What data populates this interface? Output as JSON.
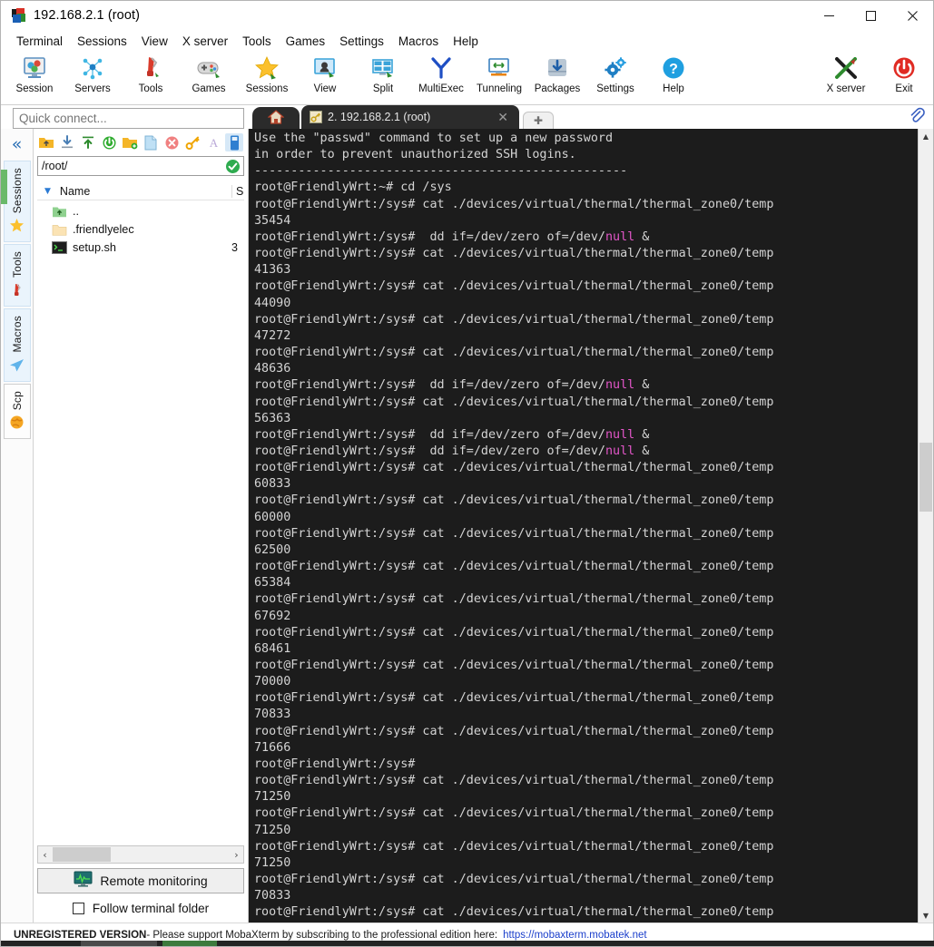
{
  "window": {
    "title": "192.168.2.1 (root)",
    "icon": "mobaxterm-logo-icon",
    "minimize": "–",
    "maximize": "□",
    "close": "✕"
  },
  "menubar": {
    "items": [
      {
        "label": "Terminal"
      },
      {
        "label": "Sessions"
      },
      {
        "label": "View"
      },
      {
        "label": "X server"
      },
      {
        "label": "Tools"
      },
      {
        "label": "Games"
      },
      {
        "label": "Settings"
      },
      {
        "label": "Macros"
      },
      {
        "label": "Help"
      }
    ]
  },
  "toolbar": {
    "buttons": [
      {
        "label": "Session",
        "icon": "session-icon"
      },
      {
        "label": "Servers",
        "icon": "servers-icon"
      },
      {
        "label": "Tools",
        "icon": "tools-knife-icon"
      },
      {
        "label": "Games",
        "icon": "gamepad-icon"
      },
      {
        "label": "Sessions",
        "icon": "star-icon"
      },
      {
        "label": "View",
        "icon": "view-monitor-icon"
      },
      {
        "label": "Split",
        "icon": "split-screen-icon"
      },
      {
        "label": "MultiExec",
        "icon": "multiexec-fork-icon"
      },
      {
        "label": "Tunneling",
        "icon": "tunneling-icon"
      },
      {
        "label": "Packages",
        "icon": "packages-download-icon"
      },
      {
        "label": "Settings",
        "icon": "gear-icon"
      },
      {
        "label": "Help",
        "icon": "help-question-icon"
      }
    ],
    "right_buttons": [
      {
        "label": "X server",
        "icon": "x-server-icon"
      },
      {
        "label": "Exit",
        "icon": "power-exit-icon"
      }
    ]
  },
  "quick_connect": {
    "placeholder": "Quick connect...",
    "value": ""
  },
  "tabs": {
    "home_icon": "home-icon",
    "active": {
      "label": "2. 192.168.2.1 (root)",
      "icon": "ssh-key-icon",
      "close": "✕"
    },
    "new_tab": "✚",
    "clip_icon": "paperclip-icon"
  },
  "rail": {
    "collapse": "«",
    "tabs": [
      {
        "label": "Sessions",
        "icon": "star-icon",
        "active": false
      },
      {
        "label": "Tools",
        "icon": "tools-knife-icon",
        "active": false
      },
      {
        "label": "Macros",
        "icon": "paper-plane-icon",
        "active": false
      },
      {
        "label": "Scp",
        "icon": "globe-icon",
        "active": true
      }
    ]
  },
  "scp": {
    "tools": [
      {
        "name": "parent-folder-icon"
      },
      {
        "name": "download-icon"
      },
      {
        "name": "upload-icon"
      },
      {
        "name": "refresh-icon"
      },
      {
        "name": "new-folder-icon"
      },
      {
        "name": "new-file-icon"
      },
      {
        "name": "delete-icon"
      },
      {
        "name": "permissions-key-icon"
      },
      {
        "name": "text-mode-icon"
      },
      {
        "name": "drive-icon"
      }
    ],
    "path": "/root/",
    "path_status_icon": "check-ok-icon",
    "columns": [
      "Name",
      "S"
    ],
    "sort_caret": "▼",
    "rows": [
      {
        "name": "..",
        "icon": "parent-folder-icon",
        "size": ""
      },
      {
        "name": ".friendlyelec",
        "icon": "folder-icon",
        "size": ""
      },
      {
        "name": "setup.sh",
        "icon": "script-file-icon",
        "size": "3"
      }
    ],
    "hscroll": {
      "left": "‹",
      "right": "›"
    },
    "remote_monitoring": {
      "label": "Remote monitoring",
      "icon": "monitor-graph-icon"
    },
    "follow_terminal": {
      "label": "Follow terminal folder",
      "checked": false
    }
  },
  "terminal": {
    "prompt_sys": "root@FriendlyWrt:/sys#",
    "prompt_home": "root@FriendlyWrt:~#",
    "cat_cmd": " cat ./devices/virtual/thermal/thermal_zone0/temp",
    "lines": [
      {
        "type": "plain",
        "text": "Use the \"passwd\" command to set up a new password"
      },
      {
        "type": "plain",
        "text": "in order to prevent unauthorized SSH logins."
      },
      {
        "type": "plain",
        "text": "---------------------------------------------------"
      },
      {
        "type": "plain",
        "text": "root@FriendlyWrt:~# cd /sys"
      },
      {
        "type": "cat"
      },
      {
        "type": "plain",
        "text": "35454"
      },
      {
        "type": "dd"
      },
      {
        "type": "cat"
      },
      {
        "type": "plain",
        "text": "41363"
      },
      {
        "type": "cat"
      },
      {
        "type": "plain",
        "text": "44090"
      },
      {
        "type": "cat"
      },
      {
        "type": "plain",
        "text": "47272"
      },
      {
        "type": "cat"
      },
      {
        "type": "plain",
        "text": "48636"
      },
      {
        "type": "dd"
      },
      {
        "type": "cat"
      },
      {
        "type": "plain",
        "text": "56363"
      },
      {
        "type": "dd"
      },
      {
        "type": "dd"
      },
      {
        "type": "cat"
      },
      {
        "type": "plain",
        "text": "60833"
      },
      {
        "type": "cat"
      },
      {
        "type": "plain",
        "text": "60000"
      },
      {
        "type": "cat"
      },
      {
        "type": "plain",
        "text": "62500"
      },
      {
        "type": "cat"
      },
      {
        "type": "plain",
        "text": "65384"
      },
      {
        "type": "cat"
      },
      {
        "type": "plain",
        "text": "67692"
      },
      {
        "type": "cat"
      },
      {
        "type": "plain",
        "text": "68461"
      },
      {
        "type": "cat"
      },
      {
        "type": "plain",
        "text": "70000"
      },
      {
        "type": "cat"
      },
      {
        "type": "plain",
        "text": "70833"
      },
      {
        "type": "cat"
      },
      {
        "type": "plain",
        "text": "71666"
      },
      {
        "type": "plain",
        "text": "root@FriendlyWrt:/sys#"
      },
      {
        "type": "cat"
      },
      {
        "type": "plain",
        "text": "71250"
      },
      {
        "type": "cat"
      },
      {
        "type": "plain",
        "text": "71250"
      },
      {
        "type": "cat"
      },
      {
        "type": "plain",
        "text": "71250"
      },
      {
        "type": "cat"
      },
      {
        "type": "plain",
        "text": "70833"
      },
      {
        "type": "cat"
      }
    ],
    "dd_prefix": "  dd if=/dev/zero of=/dev/",
    "dd_mag": "null",
    "dd_suffix": " &",
    "temperature_readings": [
      35454,
      41363,
      44090,
      47272,
      48636,
      56363,
      60833,
      60000,
      62500,
      65384,
      67692,
      68461,
      70000,
      70833,
      71666,
      71250,
      71250,
      71250,
      70833
    ]
  },
  "scrollbars": {
    "up_arrow": "▲",
    "down_arrow": "▼"
  },
  "statusbar": {
    "bold": "UNREGISTERED VERSION",
    "text": " -  Please support MobaXterm by subscribing to the professional edition here:",
    "link": "https://mobaxterm.mobatek.net"
  },
  "colors": {
    "terminal_bg": "#1c1c1c",
    "terminal_fg": "#d4d4d4",
    "magenta": "#e256c8",
    "accent_blue": "#2a6fb5",
    "link": "#1a3ecb",
    "green": "#6ab96a"
  }
}
